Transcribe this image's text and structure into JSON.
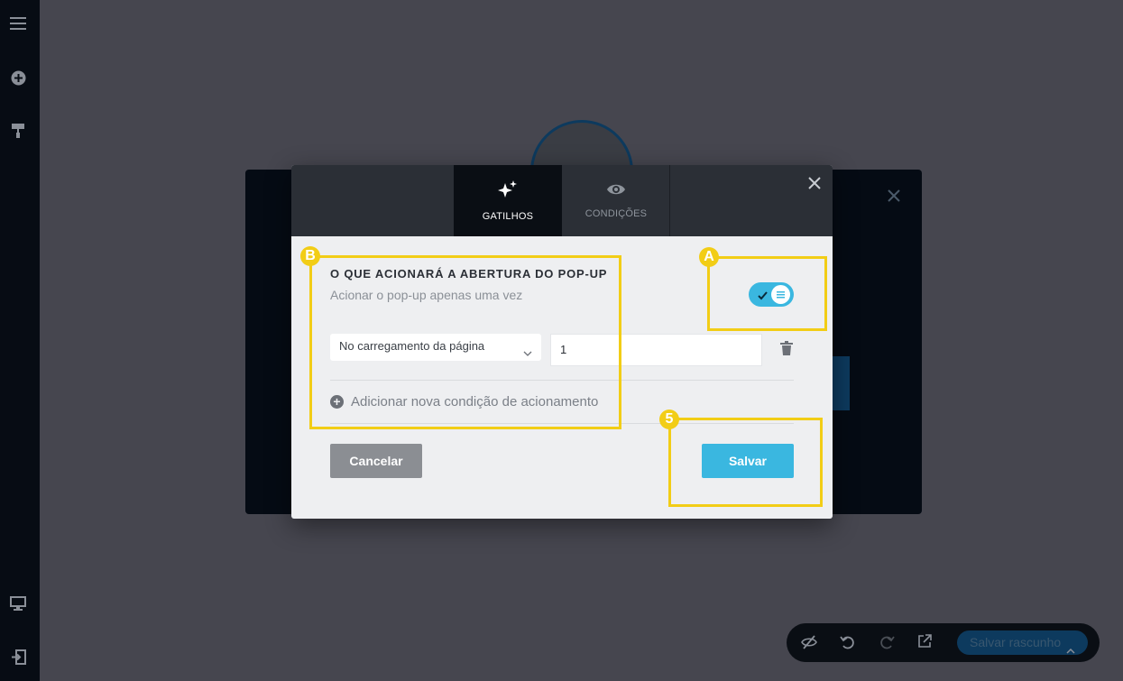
{
  "popup": {
    "tabs": [
      {
        "label": "GATILHOS",
        "icon": "sparkles-icon",
        "active": true
      },
      {
        "label": "CONDIÇÕES",
        "icon": "eye-icon",
        "active": false
      }
    ],
    "title": "O QUE ACIONARÁ A ABERTURA DO POP-UP",
    "subtitle": "Acionar o pop-up apenas uma vez",
    "toggle_on": true,
    "trigger_select": "No carregamento da página",
    "trigger_value": "1",
    "add_condition": "Adicionar nova condição de acionamento",
    "cancel_label": "Cancelar",
    "save_label": "Salvar"
  },
  "annotations": {
    "a_label": "A",
    "b_label": "B",
    "five_label": "5"
  },
  "toolbar": {
    "draft_label": "Salvar rascunho"
  },
  "colors": {
    "accent": "#3ab7e0",
    "highlight": "#f2cd16",
    "header": "#2b2f36",
    "sidebar": "#070c14"
  }
}
